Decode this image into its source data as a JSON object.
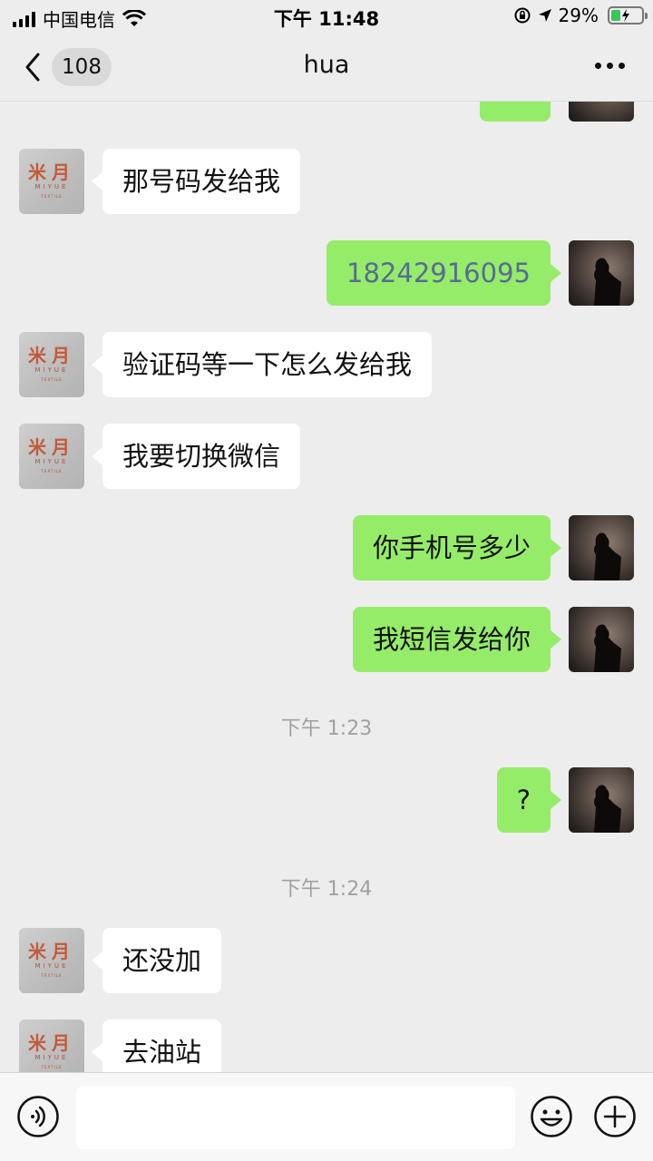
{
  "status_bar": {
    "carrier": "中国电信",
    "time": "下午 11:48",
    "battery": "29%"
  },
  "nav": {
    "unread_count": "108",
    "title": "hua"
  },
  "brand_avatar": {
    "mark": "米月",
    "name": "MIYUE",
    "sub": "TEXTILE"
  },
  "messages": [
    {
      "side": "in",
      "text": "那号码发给我"
    },
    {
      "side": "out",
      "text": "18242916095"
    },
    {
      "side": "in",
      "text": "验证码等一下怎么发给我"
    },
    {
      "side": "in",
      "text": "我要切换微信"
    },
    {
      "side": "out",
      "text": "你手机号多少"
    },
    {
      "side": "out",
      "text": "我短信发给你"
    },
    {
      "side": "out",
      "text": "?"
    },
    {
      "side": "in",
      "text": "还没加"
    },
    {
      "side": "in",
      "text": "去油站"
    }
  ],
  "timestamps": [
    "下午 1:23",
    "下午 1:24"
  ],
  "input": {
    "placeholder": "",
    "value": ""
  },
  "colors": {
    "background": "#ededed",
    "outgoing_bubble": "#95ec69",
    "incoming_bubble": "#ffffff",
    "phone_link": "#576b95"
  }
}
